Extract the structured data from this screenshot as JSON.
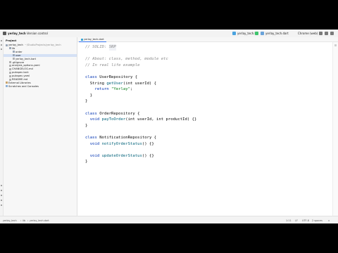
{
  "window": {
    "project_label": "yerlay_tech",
    "branch_label": "Version control",
    "run_config": "yerlay_tech.kt",
    "current_file": "yerlay_tech.dart",
    "device": "Chrome (web)"
  },
  "project_panel": {
    "title": "Project",
    "items": [
      {
        "label": "yerlay_tech",
        "sub": "~/StudioProjects/yerlay_tech",
        "depth": 0,
        "kind": "folder",
        "selected": false
      },
      {
        "label": "lib",
        "depth": 1,
        "kind": "folder",
        "selected": false
      },
      {
        "label": "order",
        "depth": 2,
        "kind": "folder",
        "selected": false
      },
      {
        "label": "user",
        "depth": 2,
        "kind": "folder",
        "selected": true
      },
      {
        "label": "yerlay_tech.kart",
        "depth": 2,
        "kind": "file",
        "selected": false
      },
      {
        "label": ".gitignore",
        "depth": 1,
        "kind": "file",
        "selected": false
      },
      {
        "label": "analysis_options.yaml",
        "depth": 1,
        "kind": "file",
        "selected": false
      },
      {
        "label": "CHANGELOG.md",
        "depth": 1,
        "kind": "file",
        "selected": false
      },
      {
        "label": "pubspec.lock",
        "depth": 1,
        "kind": "file",
        "selected": false
      },
      {
        "label": "pubspec.yaml",
        "depth": 1,
        "kind": "file",
        "selected": false
      },
      {
        "label": "README.md",
        "depth": 1,
        "kind": "file",
        "selected": false
      },
      {
        "label": "External Libraries",
        "depth": 0,
        "kind": "lib",
        "selected": false
      },
      {
        "label": "Scratches and Consoles",
        "depth": 0,
        "kind": "scratch",
        "selected": false
      }
    ]
  },
  "editor": {
    "tab_label": "yerlay_tech.dart",
    "lines": [
      [
        [
          "// SOLID: ",
          "com"
        ],
        [
          "SRP",
          "hl"
        ]
      ],
      [],
      [
        [
          "// About: class, method, module etc",
          "com"
        ]
      ],
      [
        [
          "// In real life example",
          "com"
        ]
      ],
      [],
      [
        [
          "class ",
          "kw"
        ],
        [
          "UserRepository {",
          "p"
        ]
      ],
      [
        [
          "  String ",
          "p"
        ],
        [
          "getUser",
          "fn"
        ],
        [
          "(int userId) {",
          "p"
        ]
      ],
      [
        [
          "    return ",
          "kw"
        ],
        [
          "\"Yerlay\"",
          "str"
        ],
        [
          ";",
          "p"
        ]
      ],
      [
        [
          "  }",
          "p"
        ]
      ],
      [
        [
          "}",
          "p"
        ]
      ],
      [],
      [
        [
          "class ",
          "kw"
        ],
        [
          "OrderRepository {",
          "p"
        ]
      ],
      [
        [
          "  void ",
          "kw"
        ],
        [
          "payToOrder",
          "fn"
        ],
        [
          "(int userId, int productId) {}",
          "p"
        ]
      ],
      [
        [
          "}",
          "p"
        ]
      ],
      [],
      [
        [
          "class ",
          "kw"
        ],
        [
          "NotificationRepository {",
          "p"
        ]
      ],
      [
        [
          "  void ",
          "kw"
        ],
        [
          "notifyOrderStatus",
          "fn"
        ],
        [
          "() {}",
          "p"
        ]
      ],
      [],
      [
        [
          "  void ",
          "kw"
        ],
        [
          "updateOrderStatus",
          "fn"
        ],
        [
          "() {}",
          "p"
        ]
      ],
      [
        [
          "}",
          "p"
        ]
      ]
    ]
  },
  "status_bar": {
    "breadcrumb_project": "yerlay_tech",
    "breadcrumb_lib": "lib",
    "breadcrumb_file": "yerlay_tech.dart",
    "position": "1:11",
    "line_sep": "LF",
    "encoding": "UTF-8",
    "indent": "2 spaces"
  },
  "colors": {
    "accent": "#3574f0",
    "keyword": "#0033b3",
    "function": "#00627a",
    "string": "#067d17",
    "comment": "#8c8c8c"
  }
}
